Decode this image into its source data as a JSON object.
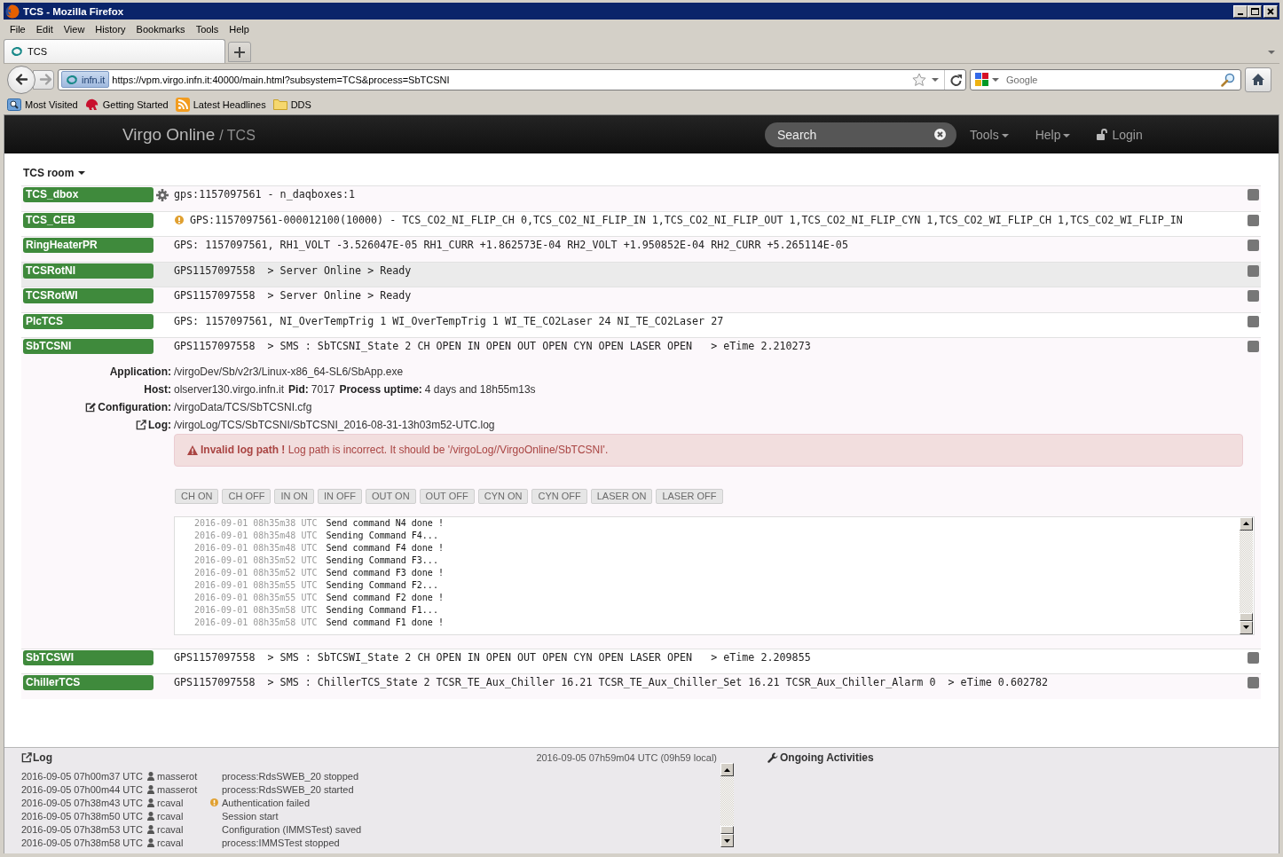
{
  "window": {
    "title": "TCS - Mozilla Firefox"
  },
  "menu_bar": [
    "File",
    "Edit",
    "View",
    "History",
    "Bookmarks",
    "Tools",
    "Help"
  ],
  "tabs": [
    {
      "label": "TCS",
      "selected": true
    }
  ],
  "address_bar": {
    "identity": "infn.it",
    "url": "https://vpm.virgo.infn.it:40000/main.html?subsystem=TCS&process=SbTCSNI"
  },
  "search_bar": {
    "placeholder": "Google"
  },
  "bookmarks": [
    {
      "label": "Most Visited",
      "kind": "smart"
    },
    {
      "label": "Getting Started",
      "kind": "page"
    },
    {
      "label": "Latest Headlines",
      "kind": "feed"
    },
    {
      "label": "DDS",
      "kind": "folder"
    }
  ],
  "navbar": {
    "brand": "Virgo Online",
    "section": "/ TCS",
    "search": {
      "placeholder": "Search"
    },
    "menus": [
      {
        "label": "Tools",
        "kind": "dropdown"
      },
      {
        "label": "Help",
        "kind": "dropdown"
      },
      {
        "label": "Login",
        "kind": "login"
      }
    ]
  },
  "room": {
    "label": "TCS room"
  },
  "processes": [
    {
      "name": "TCS_dbox",
      "kind": "settings",
      "status": "gps:1157097561 - n_daqboxes:1",
      "highlighted": false
    },
    {
      "name": "TCS_CEB",
      "kind": "warning",
      "status": "GPS:1157097561-000012100(10000) - TCS_CO2_NI_FLIP_CH 0,TCS_CO2_NI_FLIP_IN 1,TCS_CO2_NI_FLIP_OUT 1,TCS_CO2_NI_FLIP_CYN 1,TCS_CO2_WI_FLIP_CH 1,TCS_CO2_WI_FLIP_IN",
      "highlighted": false
    },
    {
      "name": "RingHeaterPR",
      "kind": "plain",
      "status": "GPS: 1157097561, RH1_VOLT -3.526047E-05 RH1_CURR +1.862573E-04 RH2_VOLT +1.950852E-04 RH2_CURR +5.265114E-05",
      "highlighted": false
    },
    {
      "name": "TCSRotNI",
      "kind": "plain",
      "status": "GPS1157097558  > Server Online > Ready",
      "highlighted": true
    },
    {
      "name": "TCSRotWI",
      "kind": "plain",
      "status": "GPS1157097558  > Server Online > Ready",
      "highlighted": false
    },
    {
      "name": "PlcTCS",
      "kind": "plain",
      "status": "GPS: 1157097561, NI_OverTempTrig 1 WI_OverTempTrig 1 WI_TE_CO2Laser 24 NI_TE_CO2Laser 27",
      "highlighted": false
    },
    {
      "name": "SbTCSNI",
      "kind": "plain",
      "status": "GPS1157097558  > SMS : SbTCSNI_State 2 CH OPEN IN OPEN OUT OPEN CYN OPEN LASER OPEN   > eTime 2.210273",
      "highlighted": false,
      "details": {
        "fields": [
          {
            "kind": "plain",
            "label": "Application:",
            "value": "/virgoDev/Sb/v2r3/Linux-x86_64-SL6/SbApp.exe"
          },
          {
            "kind": "plain",
            "label": "Host:",
            "value": "olserver130.virgo.infn.it",
            "extra": [
              {
                "label": "Pid:",
                "value": "7017"
              },
              {
                "label": "Process uptime:",
                "value": "4 days and 18h55m13s"
              }
            ]
          },
          {
            "kind": "edit",
            "label": "Configuration:",
            "value": "/virgoData/TCS/SbTCSNI.cfg"
          },
          {
            "kind": "link",
            "label": "Log:",
            "value": "/virgoLog/TCS/SbTCSNI/SbTCSNI_2016-08-31-13h03m52-UTC.log"
          }
        ],
        "alert": "**Invalid log path !** Log path is incorrect. It should be '/virgoLog//VirgoOnline/SbTCSNI'.",
        "commands": [
          "CH ON",
          "CH OFF",
          "IN ON",
          "IN OFF",
          "OUT ON",
          "OUT OFF",
          "CYN ON",
          "CYN OFF",
          "LASER ON",
          "LASER OFF"
        ],
        "log": [
          {
            "time": "2016-09-01 08h35m38 UTC",
            "message": "Send command N4 done !"
          },
          {
            "time": "2016-09-01 08h35m48 UTC",
            "message": "Sending Command F4..."
          },
          {
            "time": "2016-09-01 08h35m48 UTC",
            "message": "Send command F4 done !"
          },
          {
            "time": "2016-09-01 08h35m52 UTC",
            "message": "Sending Command F3..."
          },
          {
            "time": "2016-09-01 08h35m52 UTC",
            "message": "Send command F3 done !"
          },
          {
            "time": "2016-09-01 08h35m55 UTC",
            "message": "Sending Command F2..."
          },
          {
            "time": "2016-09-01 08h35m55 UTC",
            "message": "Send command F2 done !"
          },
          {
            "time": "2016-09-01 08h35m58 UTC",
            "message": "Sending Command F1..."
          },
          {
            "time": "2016-09-01 08h35m58 UTC",
            "message": "Send command F1 done !"
          }
        ]
      }
    },
    {
      "name": "SbTCSWI",
      "kind": "plain",
      "status": "GPS1157097558  > SMS : SbTCSWI_State 2 CH OPEN IN OPEN OUT OPEN CYN OPEN LASER OPEN   > eTime 2.209855",
      "highlighted": false
    },
    {
      "name": "ChillerTCS",
      "kind": "plain",
      "status": "GPS1157097558  > SMS : ChillerTCS_State 2 TCSR_TE_Aux_Chiller 16.21 TCSR_TE_Aux_Chiller_Set 16.21 TCSR_Aux_Chiller_Alarm 0  > eTime 0.602782",
      "highlighted": false
    }
  ],
  "footer": {
    "log_title": "Log",
    "clock": "2016-09-05 07h59m04 UTC (09h59 local)",
    "activities_title": "Ongoing Activities",
    "entries": [
      {
        "time": "2016-09-05 07h00m37 UTC",
        "user": "masserot",
        "message": "process:RdsSWEB_20 stopped",
        "warning": false
      },
      {
        "time": "2016-09-05 07h00m44 UTC",
        "user": "masserot",
        "message": "process:RdsSWEB_20 started",
        "warning": false
      },
      {
        "time": "2016-09-05 07h38m43 UTC",
        "user": "rcaval",
        "message": "Authentication failed",
        "warning": true
      },
      {
        "time": "2016-09-05 07h38m50 UTC",
        "user": "rcaval",
        "message": "Session start",
        "warning": false
      },
      {
        "time": "2016-09-05 07h38m53 UTC",
        "user": "rcaval",
        "message": "Configuration (IMMSTest) saved",
        "warning": false
      },
      {
        "time": "2016-09-05 07h38m58 UTC",
        "user": "rcaval",
        "message": "process:IMMSTest stopped",
        "warning": false
      }
    ]
  }
}
